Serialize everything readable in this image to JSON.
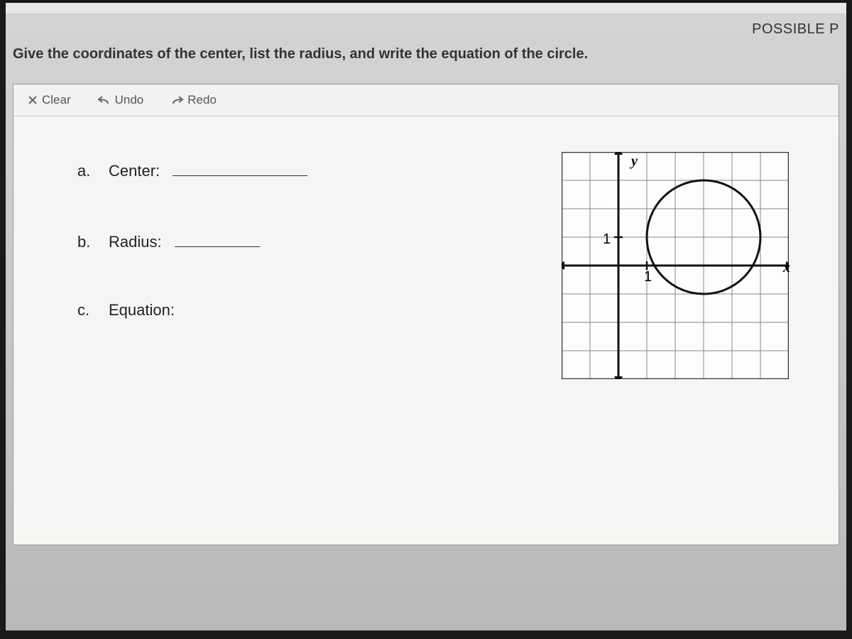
{
  "header": {
    "possible_points": "POSSIBLE P"
  },
  "instruction": "Give the coordinates of the center, list the radius, and write the equation of the circle.",
  "toolbar": {
    "clear": "Clear",
    "undo": "Undo",
    "redo": "Redo"
  },
  "prompts": {
    "a_letter": "a.",
    "a_label": "Center:",
    "b_letter": "b.",
    "b_label": "Radius:",
    "c_letter": "c.",
    "c_label": "Equation:"
  },
  "graph": {
    "x_label": "x",
    "y_label": "y",
    "tick_one_y": "1",
    "tick_one_x": "1",
    "x_min": -2,
    "x_max": 6,
    "y_min": -4,
    "y_max": 4,
    "circle_center_x": 3,
    "circle_center_y": 1,
    "circle_radius": 2
  },
  "chart_data": {
    "type": "scatter",
    "title": "",
    "xlabel": "x",
    "ylabel": "y",
    "xlim": [
      -2,
      6
    ],
    "ylim": [
      -4,
      4
    ],
    "series": [
      {
        "name": "circle",
        "shape": "circle",
        "center": [
          3,
          1
        ],
        "radius": 2
      }
    ]
  }
}
